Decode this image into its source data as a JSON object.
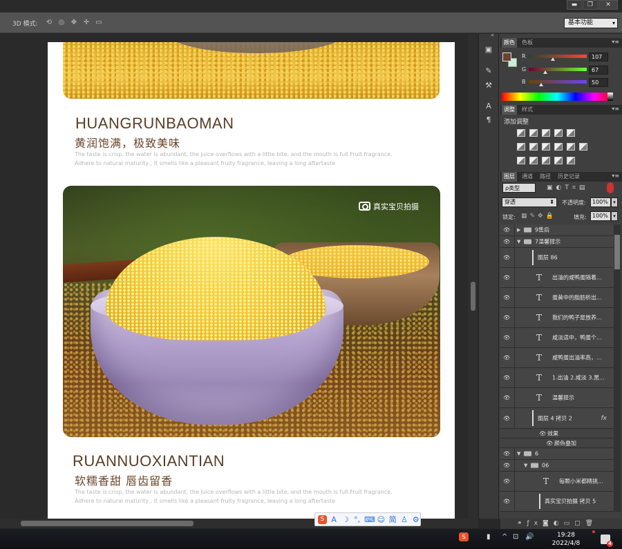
{
  "window": {
    "minimize": "▬",
    "restore": "❐",
    "close": "✕"
  },
  "options_bar": {
    "mode_label": "3D 模式:",
    "workspace": "基本功能"
  },
  "document": {
    "section1": {
      "title_en": "HUANGRUNBAOMAN",
      "title_zh": "黄润饱满，极致美味",
      "desc_line1": "The taste is crisp, the water is abundant, the juice overflows with a little bite, and the mouth is full.Fruit fragrance.",
      "desc_line2": "Adhere to natural maturity , It smells like a pleasant fruity fragrance, leaving a long aftertaste"
    },
    "photo_label": "真实宝贝拍摄",
    "section2": {
      "title_en": "RUANNUOXIANTIAN",
      "title_zh": "软糯香甜  唇齿留香",
      "desc_line1": "The taste is crisp, the water is abundant, the juice overflows with a little bite, and the mouth is full.Fruit fragrance.",
      "desc_line2": "Adhere to natural maturity , It smells like a pleasant fruity fragrance, leaving a long aftertaste"
    }
  },
  "panels": {
    "color_tabs": [
      "颜色",
      "色板"
    ],
    "rgb": [
      {
        "label": "R",
        "value": "107"
      },
      {
        "label": "G",
        "value": "67"
      },
      {
        "label": "B",
        "value": "50"
      }
    ],
    "foreground_color": "#6b4332",
    "adjust_tabs": [
      "调整",
      "样式"
    ],
    "add_adjustment": "添加调整",
    "layer_tabs": [
      "图层",
      "通道",
      "路径",
      "历史记录"
    ],
    "kind_filter": "ρ类型",
    "blend_mode": "穿透",
    "opacity_label": "不透明度:",
    "opacity_value": "100%",
    "lock_label": "锁定:",
    "fill_label": "填充:",
    "fill_value": "100%",
    "layers": [
      {
        "name": "9售后",
        "type": "group",
        "collapsed": true,
        "depth": 0
      },
      {
        "name": "7温馨提示",
        "type": "group",
        "collapsed": false,
        "depth": 0
      },
      {
        "name": "图层 86",
        "type": "pixel",
        "depth": 1
      },
      {
        "name": "出油的咸鸭蛋随着...",
        "type": "text",
        "depth": 1
      },
      {
        "name": "蛋黄中的脂肪析出...",
        "type": "text",
        "depth": 1
      },
      {
        "name": "我们的鸭子是放养...",
        "type": "text",
        "depth": 1
      },
      {
        "name": "咸淡适中，鸭蛋个...",
        "type": "text",
        "depth": 1
      },
      {
        "name": "咸鸭蛋出油率高，...",
        "type": "text",
        "depth": 1
      },
      {
        "name": "1.出油 2.咸淡 3.黑...",
        "type": "text",
        "depth": 1
      },
      {
        "name": "温馨提示",
        "type": "text",
        "depth": 1
      },
      {
        "name": "图层 4 拷贝 2",
        "type": "pixel",
        "depth": 1,
        "fx": "fx"
      },
      {
        "name": "效果",
        "type": "effect",
        "depth": 2
      },
      {
        "name": "颜色叠加",
        "type": "effect",
        "depth": 3
      },
      {
        "name": "6",
        "type": "group",
        "collapsed": false,
        "depth": 0
      },
      {
        "name": "06",
        "type": "group",
        "collapsed": false,
        "depth": 1
      },
      {
        "name": "每颗小米都精挑...",
        "type": "text",
        "depth": 2
      },
      {
        "name": "真实宝贝拍摄 拷贝 5",
        "type": "pixel",
        "depth": 2
      }
    ]
  },
  "taskbar": {
    "time": "19:28",
    "date": "2022/4/8",
    "notifications": "4"
  }
}
